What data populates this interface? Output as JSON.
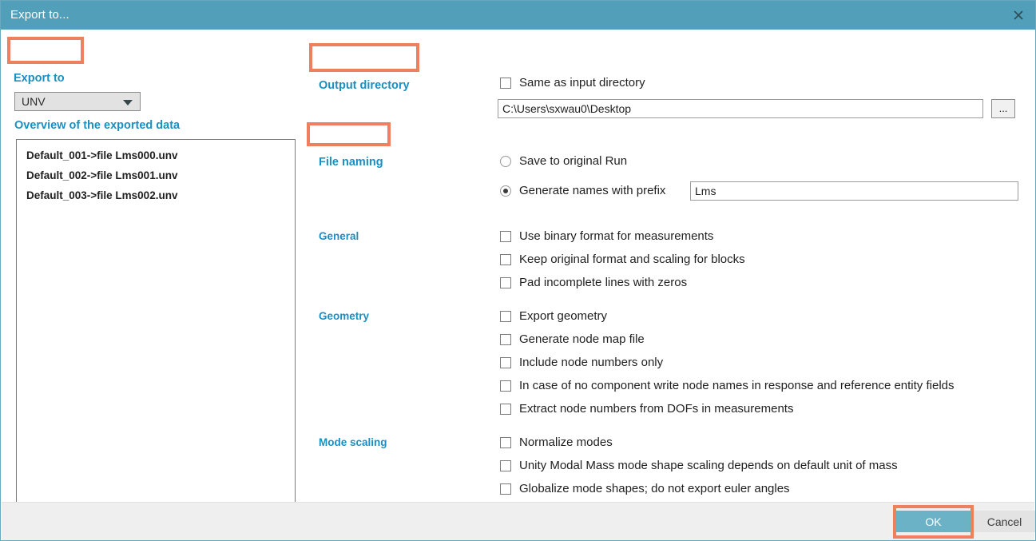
{
  "window": {
    "title": "Export to...",
    "close_icon": "close-icon",
    "titlebar_color": "#519fb8"
  },
  "export_to": {
    "heading": "Export to",
    "format_value": "UNV",
    "dropdown_icon": "chevron-down-icon",
    "overview_heading": "Overview of the exported data",
    "items": [
      "Default_001->file Lms000.unv",
      "Default_002->file Lms001.unv",
      "Default_003->file Lms002.unv"
    ]
  },
  "output_directory": {
    "heading": "Output directory",
    "same_as_input_label": "Same as input directory",
    "same_as_input_checked": false,
    "path_value": "C:\\Users\\sxwau0\\Desktop",
    "browse_label": "..."
  },
  "file_naming": {
    "heading": "File naming",
    "option_original_label": "Save to original Run",
    "option_original_selected": false,
    "option_prefix_label": "Generate names with prefix",
    "option_prefix_selected": true,
    "prefix_value": "Lms"
  },
  "general": {
    "heading": "General",
    "options": [
      {
        "label": "Use binary format for measurements",
        "checked": false
      },
      {
        "label": "Keep original format and scaling for blocks",
        "checked": false
      },
      {
        "label": "Pad incomplete lines with zeros",
        "checked": false
      }
    ]
  },
  "geometry": {
    "heading": "Geometry",
    "options": [
      {
        "label": "Export geometry",
        "checked": false
      },
      {
        "label": "Generate node map file",
        "checked": false
      },
      {
        "label": "Include node numbers only",
        "checked": false
      },
      {
        "label": "In case of no component write node names in response and reference entity fields",
        "checked": false
      },
      {
        "label": "Extract node numbers from DOFs in measurements",
        "checked": false
      }
    ]
  },
  "mode_scaling": {
    "heading": "Mode scaling",
    "options": [
      {
        "label": "Normalize modes",
        "checked": false
      },
      {
        "label": "Unity Modal Mass mode shape scaling depends on default unit of mass",
        "checked": false
      },
      {
        "label": "Globalize mode shapes; do not export euler angles",
        "checked": false
      }
    ]
  },
  "footer": {
    "ok_label": "OK",
    "cancel_label": "Cancel",
    "ok_color": "#6cb2c6"
  },
  "annotations": {
    "color": "#ee7f5f",
    "boxes": [
      "export-to",
      "output-directory",
      "file-naming",
      "ok-button"
    ]
  }
}
